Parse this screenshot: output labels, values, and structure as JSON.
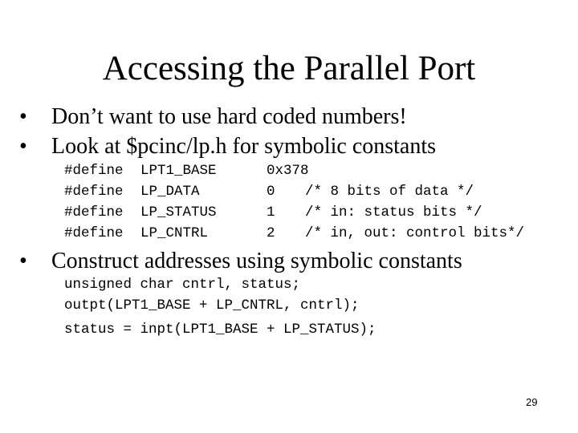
{
  "slide": {
    "title": "Accessing the Parallel Port",
    "bullet_icon": "bullet-dot",
    "bullet_glyph": "•",
    "bullets": [
      "Don’t want to use hard coded numbers!",
      "Look at $pcinc/lp.h for symbolic constants",
      "Construct addresses using symbolic constants"
    ],
    "defines": [
      {
        "keyword": "#define",
        "name": "LPT1_BASE",
        "value": "0x378",
        "comment": ""
      },
      {
        "keyword": "#define",
        "name": "LP_DATA",
        "value": "0",
        "comment": "/* 8 bits of data */"
      },
      {
        "keyword": "#define",
        "name": "LP_STATUS",
        "value": "1",
        "comment": "/* in: status bits */"
      },
      {
        "keyword": "#define",
        "name": "LP_CNTRL",
        "value": "2",
        "comment": "/* in, out: control bits*/"
      }
    ],
    "code_lines": [
      "unsigned char cntrl, status;",
      "outpt(LPT1_BASE + LP_CNTRL, cntrl);",
      "status = inpt(LPT1_BASE + LP_STATUS);"
    ],
    "page_number": "29"
  }
}
